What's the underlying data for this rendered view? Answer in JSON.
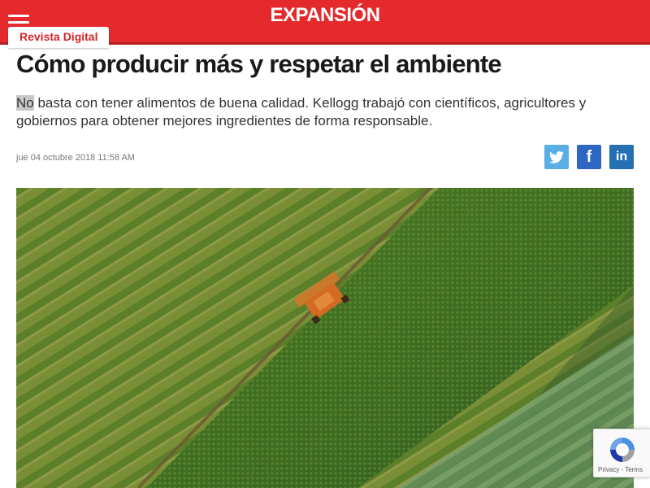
{
  "header": {
    "logo_text": "EXPANSIÓN",
    "section_label": "Revista Digital",
    "brand_color": "#e42a2d"
  },
  "article": {
    "title": "Cómo producir más y respetar el ambiente",
    "lede_first_word": "No",
    "lede_rest": " basta con tener alimentos de buena calidad. Kellogg trabajó con científicos, agricultores y gobiernos para obtener mejores ingredientes de forma responsable.",
    "date": "jue 04 octubre 2018 11:58 AM"
  },
  "share": {
    "twitter_icon": "twitter-icon",
    "facebook_icon": "facebook-icon",
    "linkedin_icon": "linkedin-icon",
    "linkedin_glyph": "in",
    "facebook_glyph": "f"
  },
  "hero_image": {
    "subject": "aerial view of a combine harvester in green crop fields"
  },
  "recaptcha": {
    "terms_text": "Privacy - Terms"
  }
}
